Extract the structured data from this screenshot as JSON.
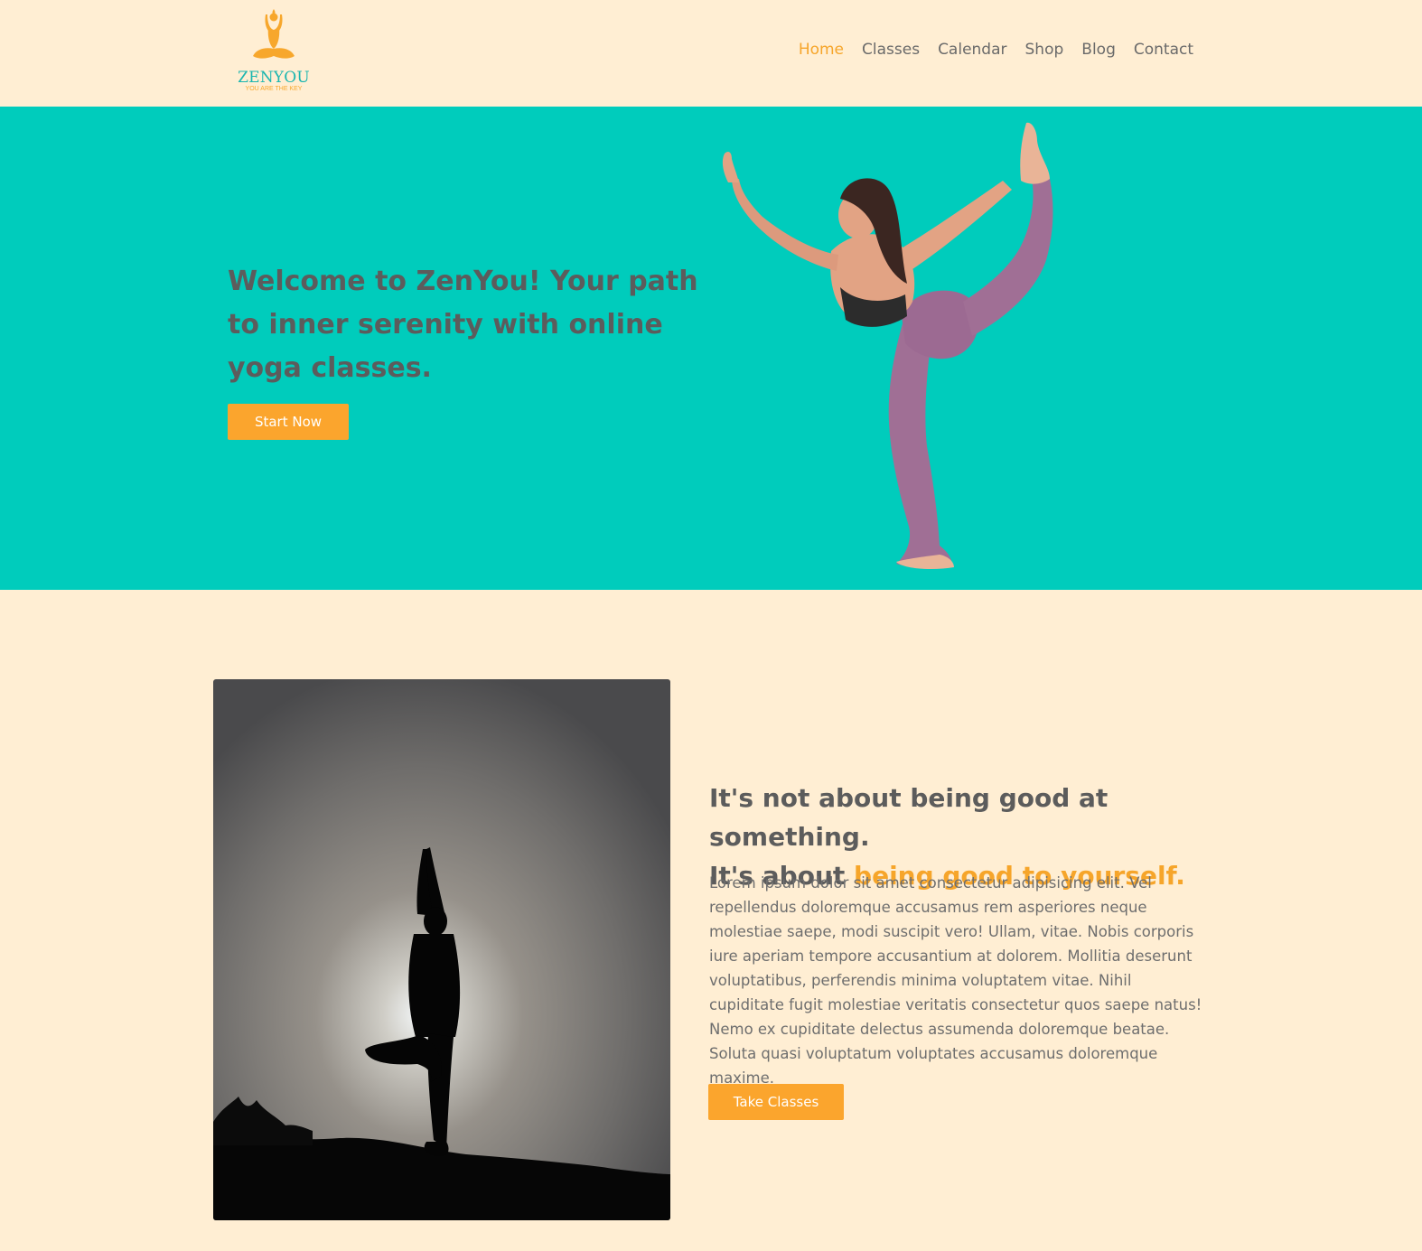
{
  "brand": {
    "name": "ZENYOU",
    "tagline": "YOU ARE THE KEY",
    "logo_icon": "meditation-figure-icon"
  },
  "nav": {
    "items": [
      {
        "label": "Home",
        "active": true
      },
      {
        "label": "Classes",
        "active": false
      },
      {
        "label": "Calendar",
        "active": false
      },
      {
        "label": "Shop",
        "active": false
      },
      {
        "label": "Blog",
        "active": false
      },
      {
        "label": "Contact",
        "active": false
      }
    ]
  },
  "hero": {
    "title": "Welcome to ZenYou! Your path to inner serenity with online yoga classes.",
    "cta_label": "Start Now"
  },
  "about": {
    "heading_part1": "It's not about being good at something.",
    "heading_part2": "It's about ",
    "heading_accent": "being good to yourself.",
    "body": "Lorem ipsum dolor sit amet consectetur adipisicing elit. Vel repellendus doloremque accusamus rem asperiores neque molestiae saepe, modi suscipit vero! Ullam, vitae. Nobis corporis iure aperiam tempore accusantium at dolorem. Mollitia deserunt voluptatibus, perferendis minima voluptatem vitae. Nihil cupiditate fugit molestiae veritatis consectetur quos saepe natus! Nemo ex cupiditate delectus assumenda doloremque beatae. Soluta quasi voluptatum voluptates accusamus doloremque maxime.",
    "cta_label": "Take Classes"
  },
  "colors": {
    "background": "#ffeed3",
    "hero_teal": "#00ccbc",
    "accent_orange": "#f6a52a",
    "text_gray": "#5c5c5c"
  }
}
